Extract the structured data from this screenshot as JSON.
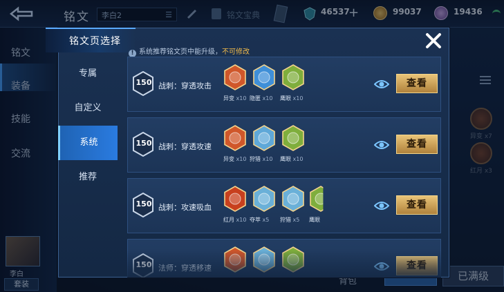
{
  "topbar": {
    "title": "铭文",
    "hero_select": "李白2",
    "faded_label": "铭文宝典",
    "res1": "46537",
    "res2": "99037",
    "res3": "19436"
  },
  "background": {
    "side_items": [
      "铭文",
      "装备",
      "技能",
      "交流"
    ],
    "avatar_name": "李白",
    "taozhuang": "套装",
    "right_labels": [
      "异变 x7",
      "红月 x3"
    ],
    "yimanji": "已满级",
    "beibao": "背包"
  },
  "modal": {
    "title": "铭文页选择",
    "notice_prefix": "系统推荐铭文页中能升级，",
    "notice_warn": "不可修改",
    "nav": [
      {
        "label": "专属"
      },
      {
        "label": "自定义"
      },
      {
        "label": "系统"
      },
      {
        "label": "推荐"
      }
    ],
    "active_nav": "系统",
    "pages": [
      {
        "level": "150",
        "name": "战刺：穿透攻击",
        "runes": [
          {
            "name": "异变",
            "count": "x10",
            "color": "#d0572a",
            "icon": "red-rune-icon"
          },
          {
            "name": "隐匿",
            "count": "x10",
            "color": "#3f8fd8",
            "icon": "blue-rune-icon"
          },
          {
            "name": "鹰眼",
            "count": "x10",
            "color": "#7fae3c",
            "icon": "green-rune-icon"
          }
        ],
        "view": "查看"
      },
      {
        "level": "150",
        "name": "战刺：穿透攻速",
        "runes": [
          {
            "name": "异变",
            "count": "x10",
            "color": "#d0572a",
            "icon": "red-rune-icon"
          },
          {
            "name": "狩猎",
            "count": "x10",
            "color": "#5fa8d8",
            "icon": "blue-rune-icon"
          },
          {
            "name": "鹰眼",
            "count": "x10",
            "color": "#7fae3c",
            "icon": "green-rune-icon"
          }
        ],
        "view": "查看"
      },
      {
        "level": "150",
        "name": "战刺：攻速吸血",
        "runes": [
          {
            "name": "红月",
            "count": "x10",
            "color": "#c8401e",
            "icon": "red-rune-icon"
          },
          {
            "name": "夺萃",
            "count": "x5",
            "color": "#6ab0d8",
            "icon": "blue-rune-icon"
          },
          {
            "name": "狩猎",
            "count": "x5",
            "color": "#6ab0d8",
            "icon": "blue-rune-icon"
          },
          {
            "name": "鹰眼",
            "count": "",
            "color": "#7fae3c",
            "icon": "green-rune-icon"
          }
        ],
        "view": "查看"
      },
      {
        "level": "150",
        "name": "法师：穿透移速",
        "runes": [
          {
            "name": "",
            "count": "",
            "color": "#d0572a",
            "icon": "red-rune-icon"
          },
          {
            "name": "",
            "count": "",
            "color": "#6ab0d8",
            "icon": "blue-rune-icon"
          },
          {
            "name": "",
            "count": "",
            "color": "#7fae3c",
            "icon": "green-rune-icon"
          }
        ],
        "view": "查看"
      }
    ]
  }
}
